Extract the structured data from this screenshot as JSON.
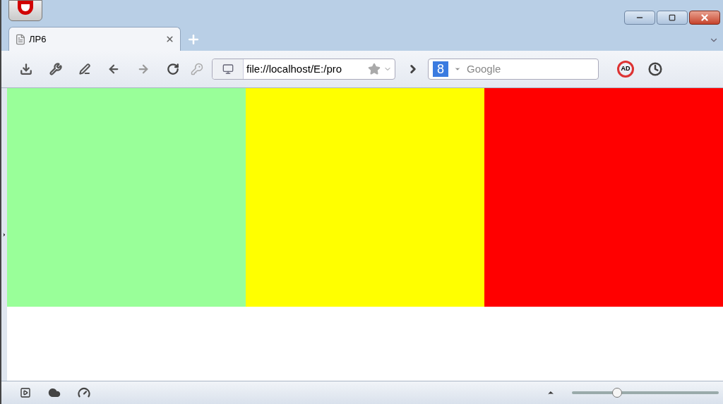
{
  "tabs": [
    {
      "label": "ЛР6",
      "selected": true
    }
  ],
  "address_bar": {
    "value": "file://localhost/E:/pro"
  },
  "search": {
    "engine_glyph": "8",
    "placeholder": "Google"
  },
  "adblock_label": "AD",
  "page": {
    "blocks": [
      {
        "color": "#99ff99"
      },
      {
        "color": "#ffff00"
      },
      {
        "color": "#ff0000"
      }
    ]
  },
  "status_bar": {
    "zoom": {
      "level": 0.31
    }
  }
}
